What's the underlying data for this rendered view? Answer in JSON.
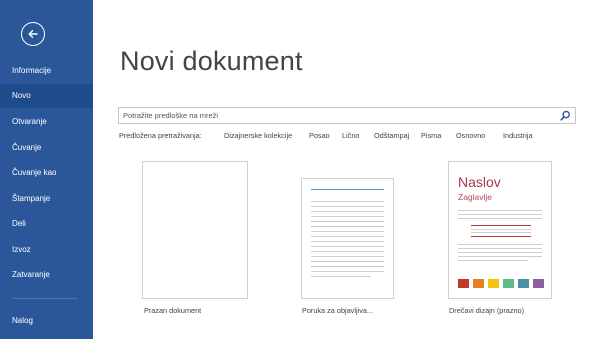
{
  "sidebar": {
    "back_label": "back",
    "items": [
      {
        "label": "Informacije",
        "active": false
      },
      {
        "label": "Novo",
        "active": true
      },
      {
        "label": "Otvaranje",
        "active": false
      },
      {
        "label": "Čuvanje",
        "active": false
      },
      {
        "label": "Čuvanje kao",
        "active": false
      },
      {
        "label": "Štampanje",
        "active": false
      },
      {
        "label": "Deli",
        "active": false
      },
      {
        "label": "Izvoz",
        "active": false
      },
      {
        "label": "Zatvaranje",
        "active": false
      }
    ],
    "account": "Nalog",
    "bg_color": "#2b579a",
    "active_color": "#1e4b8c"
  },
  "main": {
    "title": "Novi dokument",
    "search": {
      "placeholder": "Potražite predloške na mreži"
    },
    "suggested_label": "Predložena pretraživanja:",
    "suggested": [
      "Dizajnerske kolekcije",
      "Posao",
      "Lično",
      "Odštampaj",
      "Pisma",
      "Osnovno",
      "Industrija"
    ],
    "templates": [
      {
        "label": "Prazan dokument"
      },
      {
        "label": "Poruka za objavljiva..."
      },
      {
        "label": "Drečavi dizajn (prazno)",
        "heading": "Naslov",
        "subheading": "Zaglavlje"
      }
    ],
    "swatch_colors": [
      "#c0392b",
      "#e67e22",
      "#f1c40f",
      "#5dbb8a",
      "#4a90a4",
      "#8e5ea2"
    ]
  }
}
